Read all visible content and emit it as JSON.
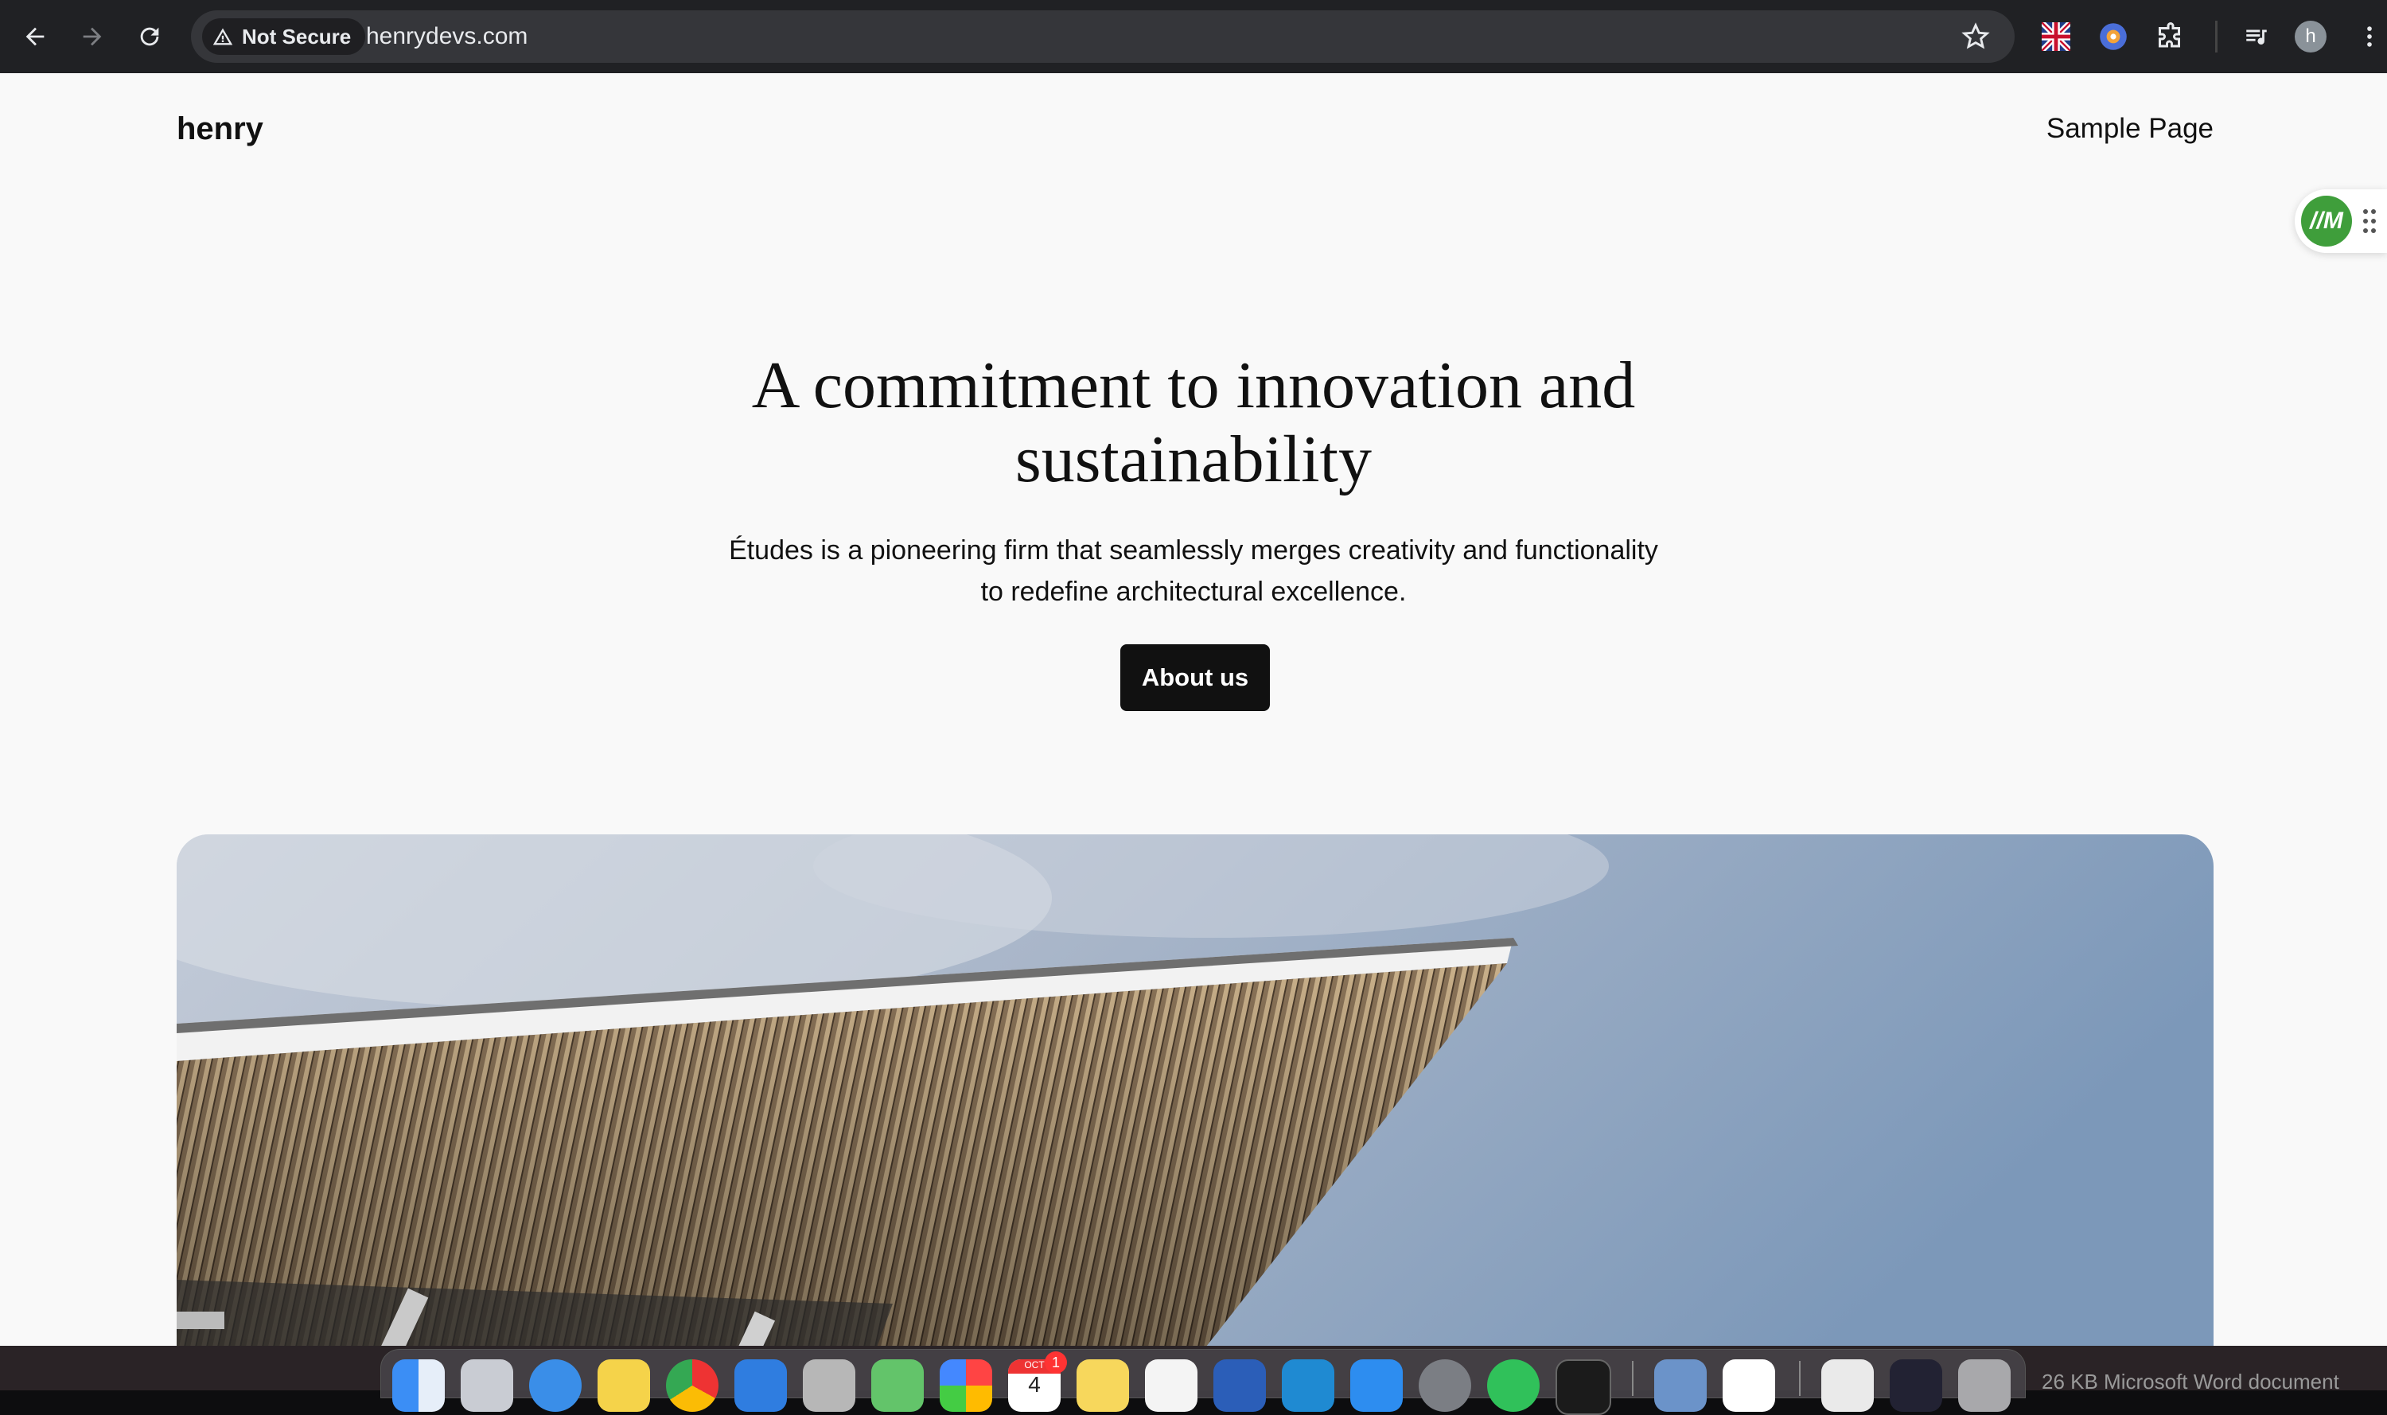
{
  "browser": {
    "security_label": "Not Secure",
    "url": "henrydevs.com",
    "profile_initial": "h",
    "extensions": [
      "uk-flag-icon",
      "globe-extension-icon",
      "puzzle-icon",
      "media-control-icon"
    ]
  },
  "site": {
    "title": "henry",
    "nav": {
      "sample_page": "Sample Page"
    },
    "widget_logo": "//M"
  },
  "hero": {
    "heading": "A commitment to innovation and sustainability",
    "subtitle": "Études is a pioneering firm that seamlessly merges creativity and functionality to redefine architectural excellence.",
    "button_label": "About us"
  },
  "dock": {
    "apps": [
      "Finder",
      "Launchpad",
      "Safari",
      "Notes",
      "Chrome",
      "Mail",
      "Contacts",
      "Maps",
      "Photos",
      "Calendar",
      "Notes",
      "Reminders",
      "Word",
      "VS Code",
      "App Store",
      "Settings",
      "WhatsApp",
      "Terminal",
      "Preview",
      "Slack",
      "Document",
      "Screenshot",
      "Trash"
    ],
    "calendar_month": "OCT",
    "calendar_day": "4",
    "calendar_badge": "1",
    "status_text": "26 KB   Microsoft Word document"
  },
  "colors": {
    "chrome_bg": "#202124",
    "page_bg": "#f9f9f9",
    "button_bg": "#111111",
    "widget_green": "#3f9e3b"
  }
}
